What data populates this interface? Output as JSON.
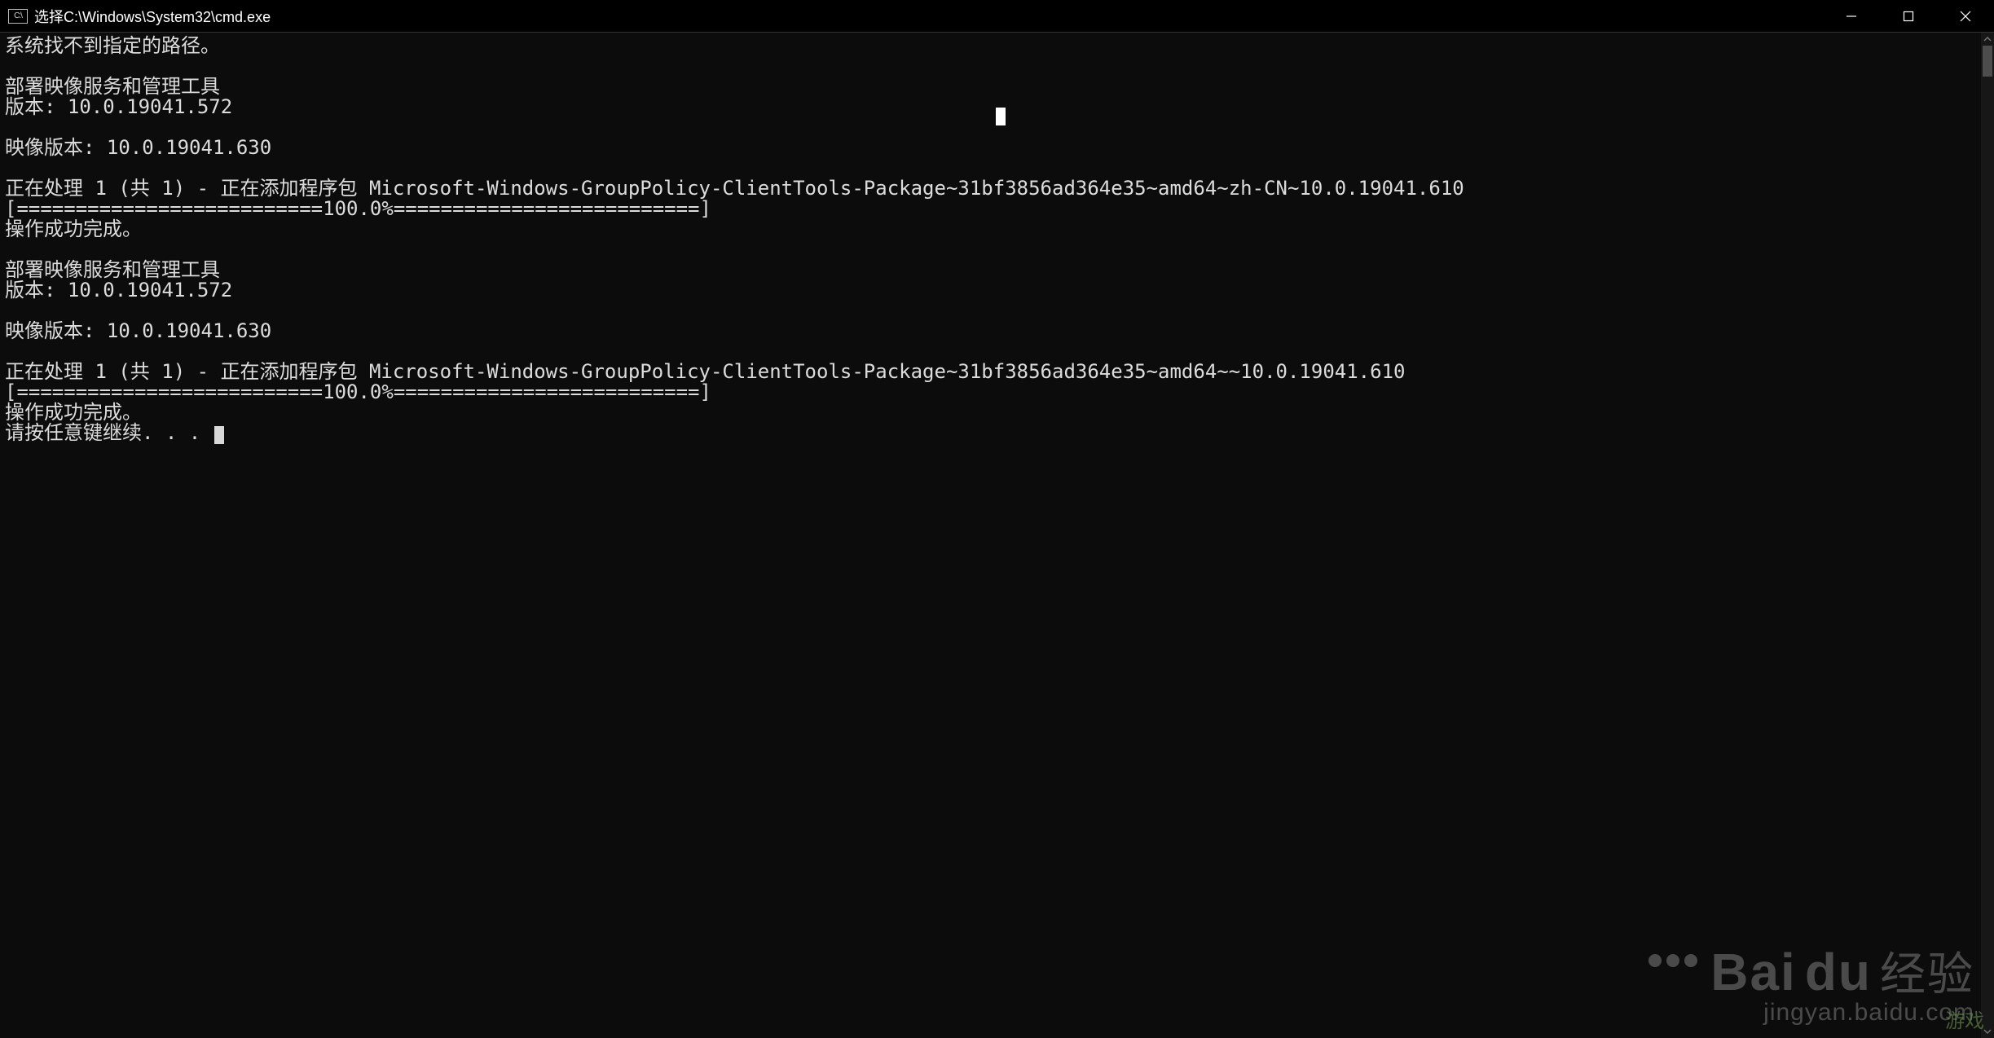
{
  "titlebar": {
    "icon_label": "C:\\",
    "title": "选择C:\\Windows\\System32\\cmd.exe"
  },
  "console": {
    "lines": [
      "系统找不到指定的路径。",
      "",
      "部署映像服务和管理工具",
      "版本: 10.0.19041.572",
      "",
      "映像版本: 10.0.19041.630",
      "",
      "正在处理 1 (共 1) - 正在添加程序包 Microsoft-Windows-GroupPolicy-ClientTools-Package~31bf3856ad364e35~amd64~zh-CN~10.0.19041.610",
      "[==========================100.0%==========================]",
      "操作成功完成。",
      "",
      "部署映像服务和管理工具",
      "版本: 10.0.19041.572",
      "",
      "映像版本: 10.0.19041.630",
      "",
      "正在处理 1 (共 1) - 正在添加程序包 Microsoft-Windows-GroupPolicy-ClientTools-Package~31bf3856ad364e35~amd64~~10.0.19041.610",
      "[==========================100.0%==========================]",
      "操作成功完成。"
    ],
    "prompt_line": "请按任意键继续. . . "
  },
  "watermark": {
    "brand": "Bai",
    "brand_suffix": "du",
    "cn": "经验",
    "url": "jingyan.baidu.com",
    "secondary": "游戏"
  }
}
